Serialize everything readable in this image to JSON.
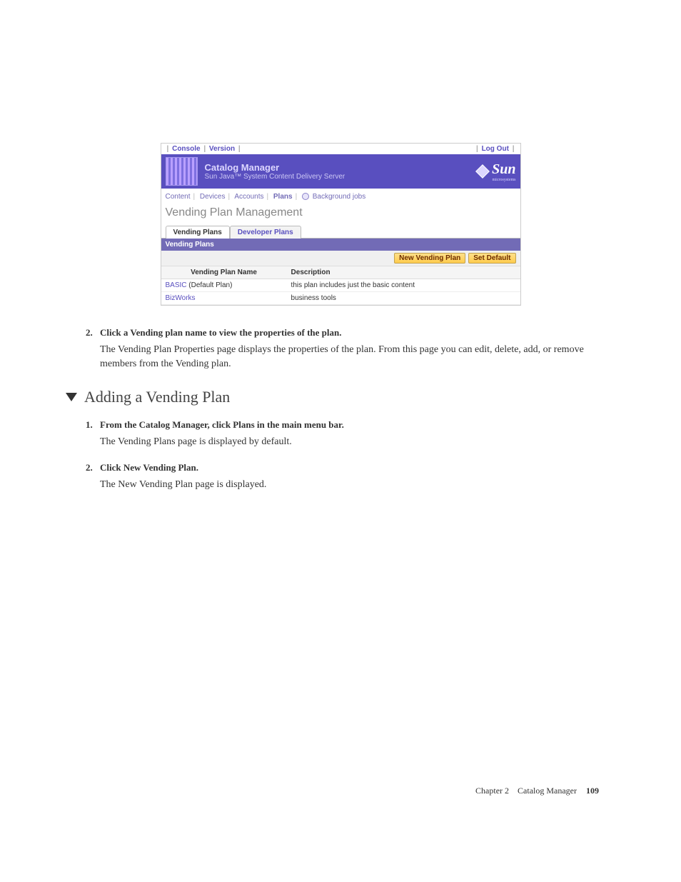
{
  "topbar": {
    "console": "Console",
    "version": "Version",
    "logout": "Log Out"
  },
  "banner": {
    "title": "Catalog Manager",
    "subtitle": "Sun Java™ System Content Delivery Server",
    "brand": "Sun",
    "tagline": "microsystems"
  },
  "menu": {
    "content": "Content",
    "devices": "Devices",
    "accounts": "Accounts",
    "plans": "Plans",
    "background": "Background jobs"
  },
  "page_heading": "Vending Plan Management",
  "tabs": {
    "vending": "Vending Plans",
    "developer": "Developer Plans"
  },
  "panel": {
    "header": "Vending Plans",
    "new_btn": "New Vending Plan",
    "default_btn": "Set Default",
    "col_name": "Vending Plan Name",
    "col_desc": "Description",
    "rows": [
      {
        "name": "BASIC",
        "suffix": " (Default Plan)",
        "desc": "this plan includes just the basic content"
      },
      {
        "name": "BizWorks",
        "suffix": "",
        "desc": "business tools"
      }
    ]
  },
  "doc": {
    "step2_num": "2.",
    "step2_label": "Click a Vending plan name to view the properties of the plan.",
    "step2_body": "The Vending Plan Properties page displays the properties of the plan. From this page you can edit, delete, add, or remove members from the Vending plan.",
    "heading": "Adding a Vending Plan",
    "s1_num": "1.",
    "s1_label": "From the Catalog Manager, click Plans in the main menu bar.",
    "s1_body": "The Vending Plans page is displayed by default.",
    "s2_num": "2.",
    "s2_label": "Click New Vending Plan.",
    "s2_body": "The New Vending Plan page is displayed."
  },
  "footer": {
    "chapter": "Chapter 2",
    "title": "Catalog Manager",
    "page": "109"
  }
}
